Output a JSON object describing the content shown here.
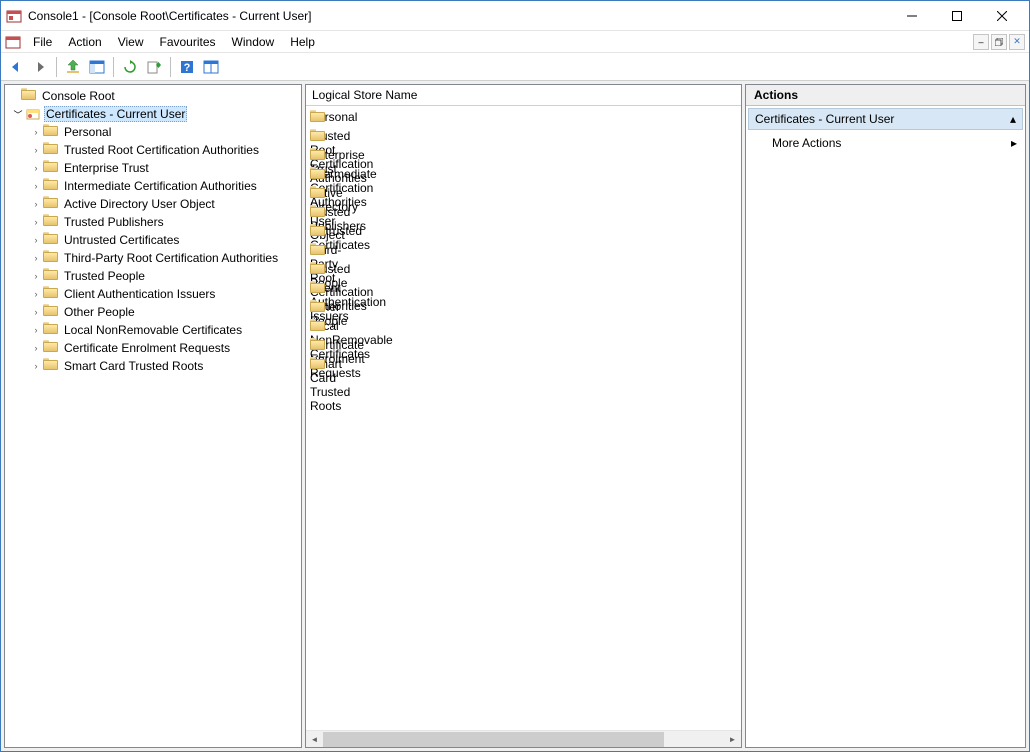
{
  "window": {
    "title": "Console1 - [Console Root\\Certificates - Current User]"
  },
  "menus": [
    "File",
    "Action",
    "View",
    "Favourites",
    "Window",
    "Help"
  ],
  "tree": {
    "root": "Console Root",
    "selected": "Certificates - Current User",
    "children": [
      "Personal",
      "Trusted Root Certification Authorities",
      "Enterprise Trust",
      "Intermediate Certification Authorities",
      "Active Directory User Object",
      "Trusted Publishers",
      "Untrusted Certificates",
      "Third-Party Root Certification Authorities",
      "Trusted People",
      "Client Authentication Issuers",
      "Other People",
      "Local NonRemovable Certificates",
      "Certificate Enrolment Requests",
      "Smart Card Trusted Roots"
    ]
  },
  "list": {
    "header": "Logical Store Name",
    "items": [
      "Personal",
      "Trusted Root Certification Authorities",
      "Enterprise Trust",
      "Intermediate Certification Authorities",
      "Active Directory User Object",
      "Trusted Publishers",
      "Untrusted Certificates",
      "Third-Party Root Certification Authorities",
      "Trusted People",
      "Client Authentication Issuers",
      "Other People",
      "Local NonRemovable Certificates",
      "Certificate Enrolment Requests",
      "Smart Card Trusted Roots"
    ]
  },
  "actions": {
    "header": "Actions",
    "section": "Certificates - Current User",
    "more": "More Actions"
  }
}
